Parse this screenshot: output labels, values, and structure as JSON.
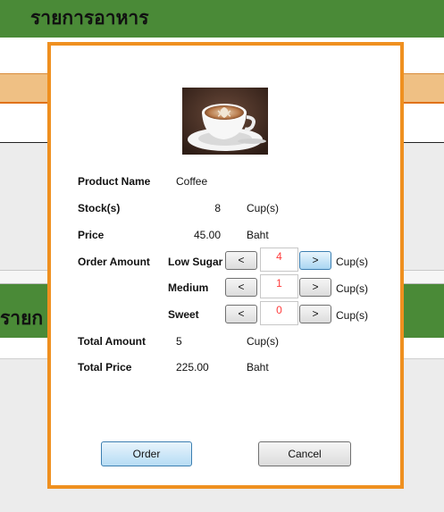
{
  "background": {
    "title": "รายการอาหาร",
    "title2_partial": "รายก"
  },
  "dialog": {
    "product_name_label": "Product Name",
    "product_name": "Coffee",
    "stock_label": "Stock(s)",
    "stock_value": "8",
    "stock_unit": "Cup(s)",
    "price_label": "Price",
    "price_value": "45.00",
    "price_unit": "Baht",
    "order_amount_label": "Order Amount",
    "options": [
      {
        "label": "Low Sugar",
        "value": "4",
        "unit": "Cup(s)"
      },
      {
        "label": "Medium",
        "value": "1",
        "unit": "Cup(s)"
      },
      {
        "label": "Sweet",
        "value": "0",
        "unit": "Cup(s)"
      }
    ],
    "decrement_label": "<",
    "increment_label": ">",
    "total_amount_label": "Total Amount",
    "total_amount": "5",
    "total_amount_unit": "Cup(s)",
    "total_price_label": "Total Price",
    "total_price": "225.00",
    "total_price_unit": "Baht",
    "order_button": "Order",
    "cancel_button": "Cancel"
  },
  "colors": {
    "header_green": "#4a8a37",
    "dialog_border": "#ef9020",
    "count_text": "#ff3b3b"
  }
}
